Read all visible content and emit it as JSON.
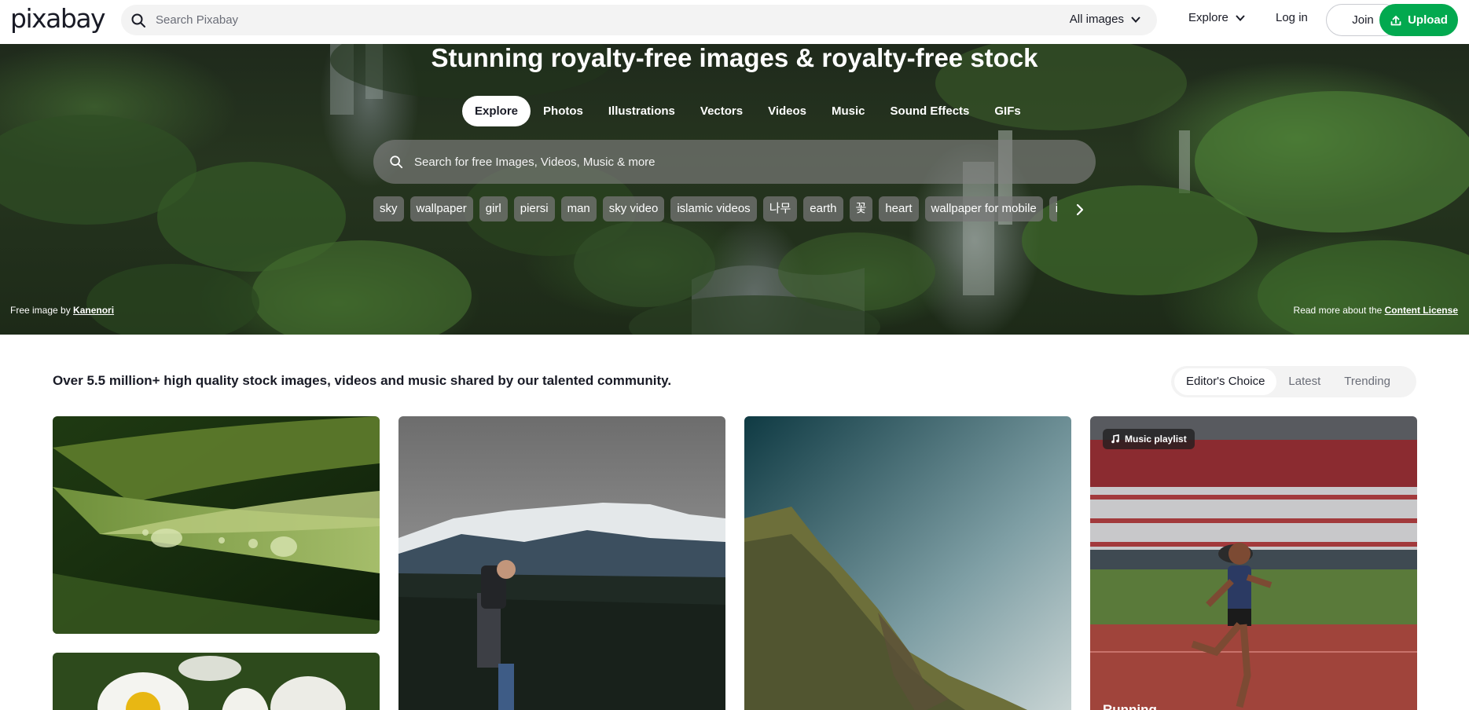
{
  "header": {
    "logo_text": "pixabay",
    "search_placeholder": "Search Pixabay",
    "filter_label": "All images",
    "explore_label": "Explore",
    "login_label": "Log in",
    "join_label": "Join",
    "upload_label": "Upload",
    "accent_color": "#02a94f"
  },
  "hero": {
    "title": "Stunning royalty-free images & royalty-free stock",
    "tabs": [
      {
        "label": "Explore",
        "active": true
      },
      {
        "label": "Photos",
        "active": false
      },
      {
        "label": "Illustrations",
        "active": false
      },
      {
        "label": "Vectors",
        "active": false
      },
      {
        "label": "Videos",
        "active": false
      },
      {
        "label": "Music",
        "active": false
      },
      {
        "label": "Sound Effects",
        "active": false
      },
      {
        "label": "GIFs",
        "active": false
      }
    ],
    "search_placeholder": "Search for free Images, Videos, Music & more",
    "tags": [
      "sky",
      "wallpaper",
      "girl",
      "piersi",
      "man",
      "sky video",
      "islamic videos",
      "나무",
      "earth",
      "꽃",
      "heart",
      "wallpaper for mobile",
      "ig"
    ],
    "credit_prefix": "Free image by",
    "credit_author": "Kanenori",
    "license_prefix": "Read more about the",
    "license_link": "Content License"
  },
  "content": {
    "lead_text": "Over 5.5 million+ high quality stock images, videos and music shared by our talented community.",
    "filters": [
      {
        "label": "Editor's Choice",
        "active": true
      },
      {
        "label": "Latest",
        "active": false
      },
      {
        "label": "Trending",
        "active": false
      }
    ],
    "cards": [
      {
        "id": "leaf-droplets",
        "badge": "",
        "title": ""
      },
      {
        "id": "mountain-hiker",
        "badge": "",
        "title": ""
      },
      {
        "id": "cliff-sky",
        "badge": "",
        "title": ""
      },
      {
        "id": "running-track",
        "badge": "Music playlist",
        "title": "Running"
      },
      {
        "id": "daisies",
        "badge": "",
        "title": ""
      }
    ]
  }
}
